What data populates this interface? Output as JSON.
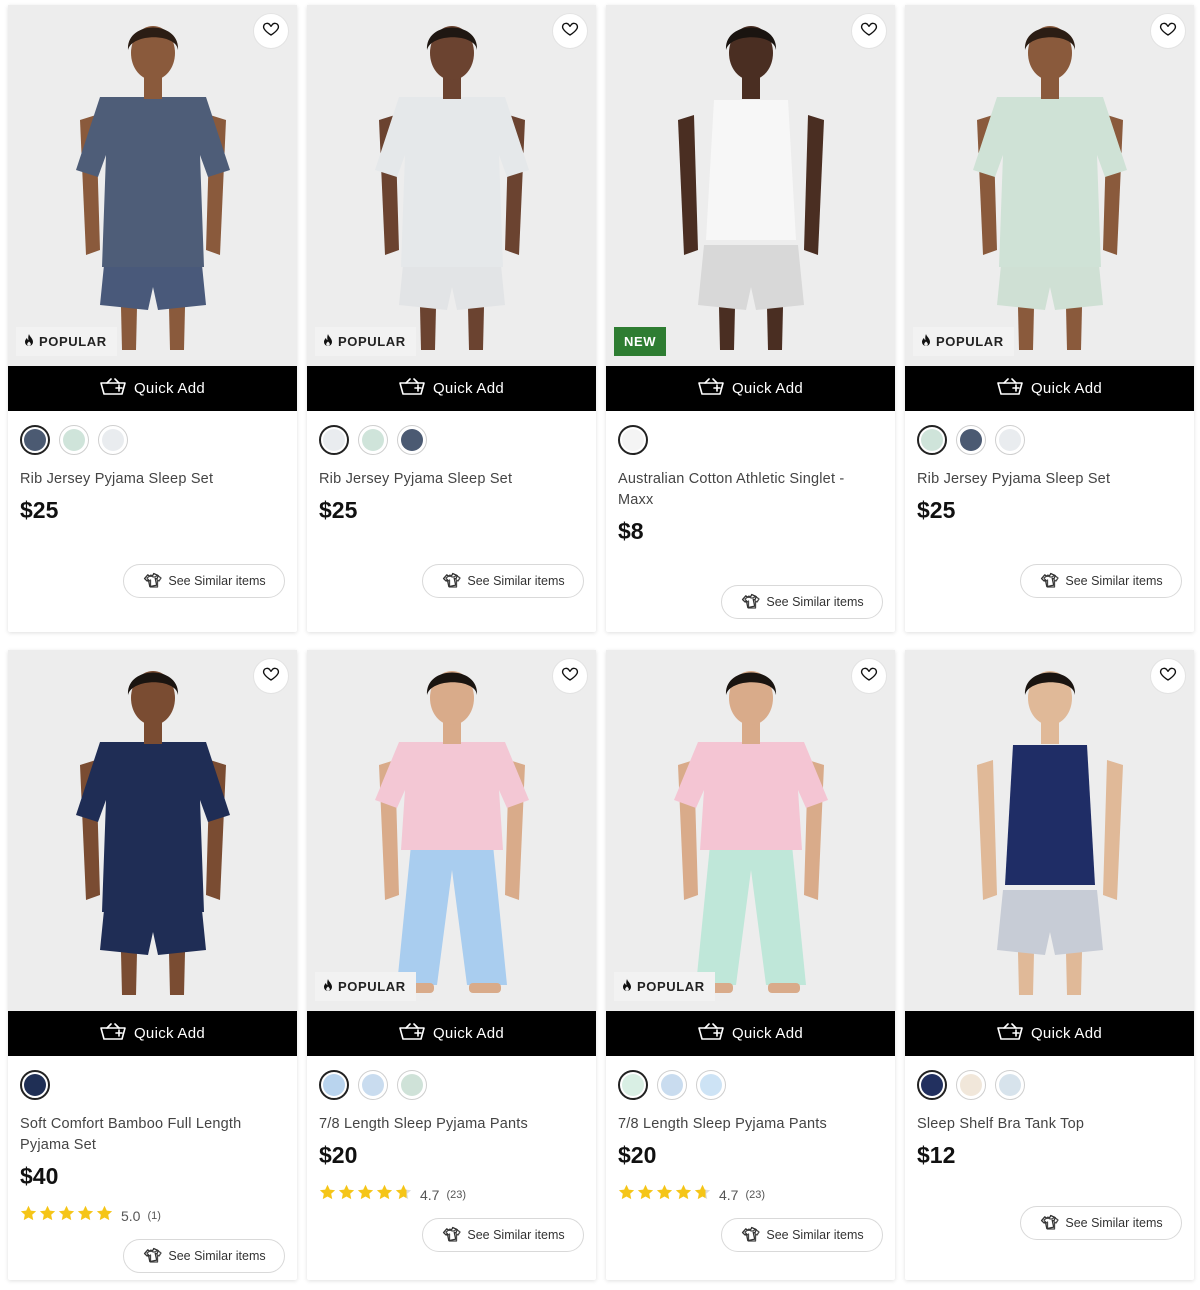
{
  "labels": {
    "quick_add": "Quick Add",
    "see_similar": "See Similar items"
  },
  "colors": {
    "quick_add_bg": "#000000",
    "new_badge": "#2e7d32",
    "popular_badge_bg": "#f2f2f2",
    "star": "#f5c518"
  },
  "products": [
    {
      "name": "Rib Jersey Pyjama Sleep Set",
      "price": "$25",
      "badge": "POPULAR",
      "swatches": [
        "#4b5a72",
        "#cfe4da",
        "#e9ecef"
      ],
      "selected_swatch": 0,
      "image_description_icon": "model-photo",
      "outfit": {
        "top": "#4e5d78",
        "bottom": "#49597a",
        "skin": "#8a5a3c",
        "hair": "#2b1d14"
      }
    },
    {
      "name": "Rib Jersey Pyjama Sleep Set",
      "price": "$25",
      "badge": "POPULAR",
      "swatches": [
        "#e9ecef",
        "#cfe4da",
        "#4b5a72"
      ],
      "selected_swatch": 0,
      "outfit": {
        "top": "#e5e8ea",
        "bottom": "#e2e4e6",
        "skin": "#6b4330",
        "hair": "#1f1712"
      }
    },
    {
      "name": "Australian Cotton Athletic Singlet - Maxx",
      "price": "$8",
      "badge": "NEW",
      "swatches": [
        "#f4f4f4"
      ],
      "selected_swatch": 0,
      "outfit": {
        "top": "#f7f7f7",
        "bottom": "#d8d8d8",
        "skin": "#4a2e22",
        "hair": "#1a1410"
      }
    },
    {
      "name": "Rib Jersey Pyjama Sleep Set",
      "price": "$25",
      "badge": "POPULAR",
      "swatches": [
        "#cfe4da",
        "#4b5a72",
        "#e9ecef"
      ],
      "selected_swatch": 0,
      "outfit": {
        "top": "#cfe2d6",
        "bottom": "#cfe0d4",
        "skin": "#8a5a3c",
        "hair": "#2b1d14"
      }
    },
    {
      "name": "Soft Comfort Bamboo Full Length Pyjama Set",
      "price": "$40",
      "badge": "",
      "swatches": [
        "#1f2f55"
      ],
      "selected_swatch": 0,
      "rating": "5.0",
      "rating_count": "(1)",
      "rating_value": 5.0,
      "outfit": {
        "top": "#1f2d55",
        "bottom": "#1f2d55",
        "skin": "#7a4c32",
        "hair": "#1a1410"
      }
    },
    {
      "name": "7/8 Length Sleep Pyjama Pants",
      "price": "$20",
      "badge": "POPULAR",
      "swatches": [
        "#b9d4ee",
        "#c9dcef",
        "#cfe2d8"
      ],
      "selected_swatch": 0,
      "rating": "4.7",
      "rating_count": "(23)",
      "rating_value": 4.7,
      "outfit": {
        "top": "#f3c7d4",
        "bottom": "#a9cdef",
        "skin": "#d9ab8a",
        "hair": "#1a1410"
      }
    },
    {
      "name": "7/8 Length Sleep Pyjama Pants",
      "price": "$20",
      "badge": "POPULAR",
      "swatches": [
        "#d9efe4",
        "#c9dcef",
        "#cde3f5"
      ],
      "selected_swatch": 0,
      "rating": "4.7",
      "rating_count": "(23)",
      "rating_value": 4.7,
      "outfit": {
        "top": "#f4c5d3",
        "bottom": "#bfe7d9",
        "skin": "#d9ab8a",
        "hair": "#1a1410"
      }
    },
    {
      "name": "Sleep Shelf Bra Tank Top",
      "price": "$12",
      "badge": "",
      "swatches": [
        "#22305f",
        "#f1e7da",
        "#d7e3ec"
      ],
      "selected_swatch": 0,
      "outfit": {
        "top": "#1f2d66",
        "bottom": "#c7ccd6",
        "skin": "#e0b998",
        "hair": "#1a1410"
      }
    }
  ]
}
